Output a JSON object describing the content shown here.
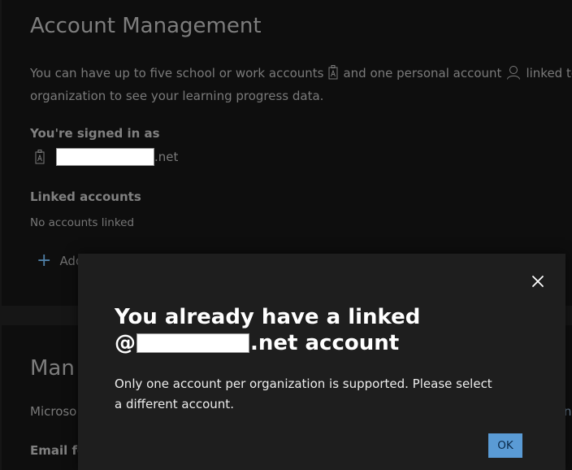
{
  "page": {
    "title": "Account Management",
    "description_line1_a": "You can have up to five school or work accounts",
    "description_line1_b": "and one personal account",
    "description_line1_c": "linked to yo",
    "description_line2": "organization to see your learning progress data.",
    "signed_in_label": "You're signed in as",
    "signed_in_domain": ".net",
    "linked_accounts_label": "Linked accounts",
    "no_accounts_text": "No accounts linked",
    "add_button_label": "Add"
  },
  "bottom_section": {
    "title": "Man",
    "description": "Microso",
    "email_label": "Email fo",
    "right_edge_text": "n"
  },
  "modal": {
    "title_line1": "You already have a linked",
    "title_at": "@",
    "title_domain": ".net account",
    "body": "Only one account per organization is supported. Please select a different account.",
    "ok_label": "OK"
  },
  "icons": {
    "work_account": "badge-icon",
    "personal_account": "person-icon",
    "close": "close-icon",
    "add": "plus-icon"
  },
  "colors": {
    "accent": "#5a9bd5",
    "modal_bg": "#1e1e1e",
    "page_bg": "#0e0e0e"
  }
}
